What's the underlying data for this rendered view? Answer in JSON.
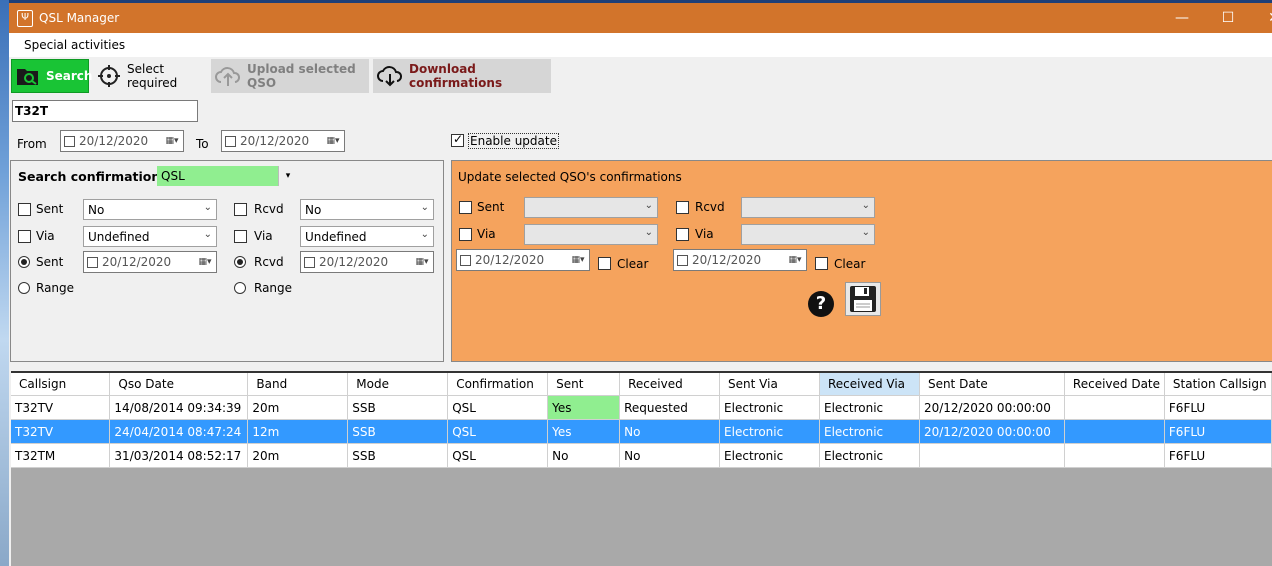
{
  "window": {
    "title": "QSL Manager",
    "minimize": "—",
    "maximize": "☐",
    "close": "✕"
  },
  "menu": {
    "special": "Special activities"
  },
  "toolbar": {
    "search": "Search",
    "select_required": "Select required",
    "upload": "Upload selected QSO",
    "download": "Download confirmations"
  },
  "filter": {
    "callsign": "T32T",
    "from_label": "From",
    "from_date": "20/12/2020",
    "to_label": "To",
    "to_date": "20/12/2020",
    "enable_update": "Enable update"
  },
  "search_panel": {
    "title": "Search confirmation",
    "confirmation_type": "QSL",
    "sent_label": "Sent",
    "sent_value": "No",
    "rcvd_label": "Rcvd",
    "rcvd_value": "No",
    "via_label": "Via",
    "via_sent_value": "Undefined",
    "via_rcvd_value": "Undefined",
    "sent_date_label": "Sent",
    "sent_date": "20/12/2020",
    "rcvd_date_label": "Rcvd",
    "rcvd_date": "20/12/2020",
    "range_label": "Range"
  },
  "update_panel": {
    "title": "Update selected QSO's confirmations",
    "sent_label": "Sent",
    "rcvd_label": "Rcvd",
    "via_label": "Via",
    "sent_date": "20/12/2020",
    "rcvd_date": "20/12/2020",
    "clear_label": "Clear"
  },
  "table": {
    "columns": [
      "Callsign",
      "Qso Date",
      "Band",
      "Mode",
      "Confirmation",
      "Sent",
      "Received",
      "Sent Via",
      "Received Via",
      "Sent Date",
      "Received Date",
      "Station Callsign"
    ],
    "rows": [
      [
        "T32TV",
        "14/08/2014 09:34:39",
        "20m",
        "SSB",
        "QSL",
        "Yes",
        "Requested",
        "Electronic",
        "Electronic",
        "20/12/2020 00:00:00",
        "",
        "F6FLU"
      ],
      [
        "T32TV",
        "24/04/2014 08:47:24",
        "12m",
        "SSB",
        "QSL",
        "Yes",
        "No",
        "Electronic",
        "Electronic",
        "20/12/2020 00:00:00",
        "",
        "F6FLU"
      ],
      [
        "T32TM",
        "31/03/2014 08:52:17",
        "20m",
        "SSB",
        "QSL",
        "No",
        "No",
        "Electronic",
        "Electronic",
        "",
        "",
        "F6FLU"
      ]
    ]
  },
  "colors": {
    "title_bar": "#d2742b",
    "search_btn": "#19c435",
    "update_panel": "#f5a35d",
    "highlight": "#90ee90",
    "selection": "#3399ff"
  }
}
